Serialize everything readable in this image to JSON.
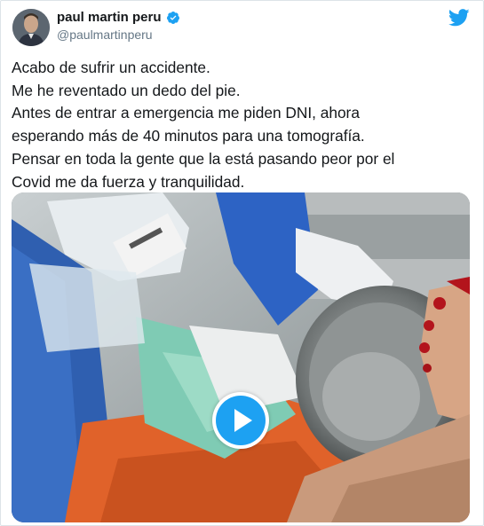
{
  "author": {
    "display_name": "paul martin peru",
    "handle": "@paulmartinperu",
    "verified": true
  },
  "tweet": {
    "lines": [
      "Acabo de sufrir un accidente.",
      "Me he reventado un dedo del pie.",
      "Antes de entrar a emergencia me piden DNI, ahora",
      "esperando más de 40 minutos para una tomografía.",
      "Pensar en toda la gente que la está pasando peor por el",
      "Covid me da fuerza y tranquilidad."
    ]
  },
  "media": {
    "type": "video",
    "play_icon": "play-icon"
  },
  "icons": {
    "brand": "twitter-bird-icon",
    "verified": "verified-badge-icon"
  },
  "colors": {
    "twitter_blue": "#1da1f2",
    "text": "#14171a",
    "secondary_text": "#657786"
  }
}
